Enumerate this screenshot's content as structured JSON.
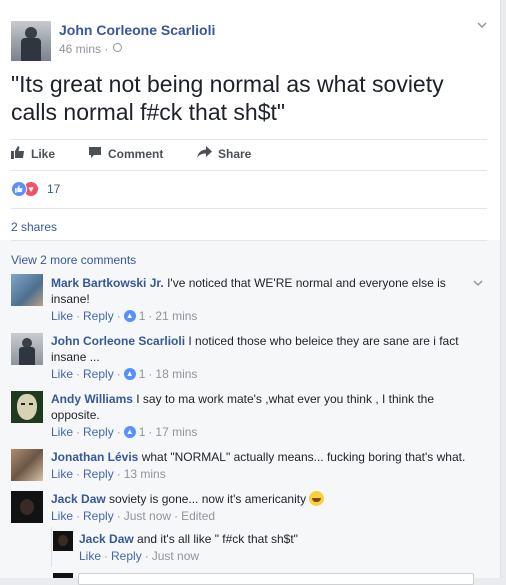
{
  "post": {
    "author": "John Corleone Scarlioli",
    "time": "46 mins",
    "time_separator": "·",
    "text": "\"Its great not being normal as what soviety calls normal f#ck that sh$t\"",
    "actions": {
      "like": "Like",
      "comment": "Comment",
      "share": "Share"
    },
    "reaction_count": "17",
    "shares": "2 shares"
  },
  "comments_section": {
    "view_more": "View 2 more comments",
    "comments": [
      {
        "author": "Mark Bartkowski Jr.",
        "text_line1": "I've noticed that WE'RE normal and everyone else is",
        "text_line2": "insane!",
        "like": "Like",
        "reply": "Reply",
        "likes": "1",
        "time": "21 mins"
      },
      {
        "author": "John Corleone Scarlioli",
        "text_line1": "I noticed those who beleice they are sane are i fact",
        "text_line2": "insane ...",
        "like": "Like",
        "reply": "Reply",
        "likes": "1",
        "time": "18 mins"
      },
      {
        "author": "Andy Williams",
        "text_line1": "I say to ma work mate's ,what ever you think , I think the",
        "text_line2": "opposite.",
        "like": "Like",
        "reply": "Reply",
        "likes": "1",
        "time": "17 mins"
      },
      {
        "author": "Jonathan Lévis",
        "text_line1": "what \"NORMAL\" actually means... fucking boring that's what.",
        "like": "Like",
        "reply": "Reply",
        "time": "13 mins"
      },
      {
        "author": "Jack Daw",
        "text_line1": "soviety is gone... now it's americanity",
        "like": "Like",
        "reply": "Reply",
        "time": "Just now",
        "edited": "Edited"
      }
    ],
    "reply": {
      "author": "Jack Daw",
      "text": "and it's all like \" f#ck that sh$t\"",
      "like": "Like",
      "reply": "Reply",
      "time": "Just now"
    },
    "separator": "·"
  },
  "colors": {
    "link": "#365899",
    "meta": "#90949c",
    "like_blue": "#5890ff",
    "love_red": "#f25268",
    "background": "#e9ebee"
  },
  "icons": {
    "chevron": "chevron-down-icon",
    "globe": "globe-icon",
    "like": "thumbs-up-icon",
    "comment": "comment-bubble-icon",
    "share": "share-arrow-icon"
  }
}
